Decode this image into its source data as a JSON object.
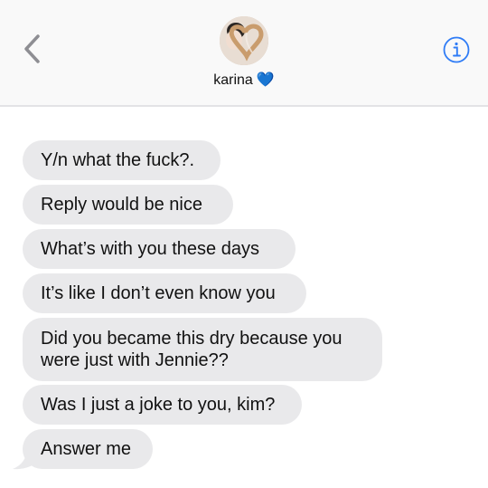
{
  "header": {
    "contact_name": "karina",
    "contact_emoji": "💙"
  },
  "icons": {
    "back": "chevron-left-icon",
    "info": "info-circle-icon"
  },
  "colors": {
    "accent": "#2f7cf6",
    "received_bubble": "#e9e9eb",
    "header_bg": "#f9f9f9"
  },
  "messages": [
    {
      "text": "Y/n what the fuck?."
    },
    {
      "text": "Reply would be nice"
    },
    {
      "text": "What’s with you these days"
    },
    {
      "text": "It’s like I don’t even know you"
    },
    {
      "text": "Did you became this dry because you were just with Jennie??"
    },
    {
      "text": "Was I just a joke to you, kim?"
    },
    {
      "text": "Answer me"
    }
  ]
}
